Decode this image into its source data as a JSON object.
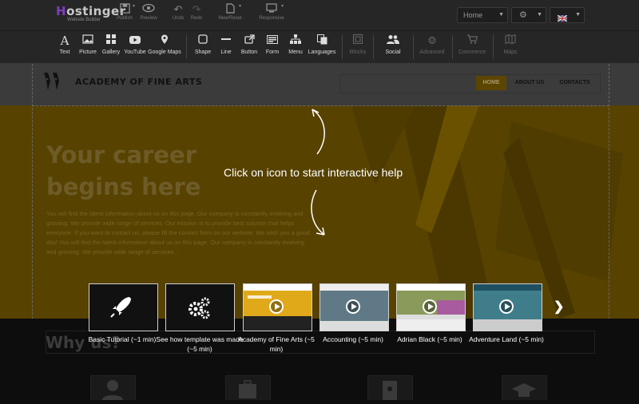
{
  "app": {
    "logo_text": "ostinger",
    "logo_initial": "H",
    "logo_subtitle": "Website Builder"
  },
  "topbar": {
    "buttons": [
      {
        "name": "publish",
        "label": "Publish",
        "icon": "save-icon"
      },
      {
        "name": "preview",
        "label": "Preview",
        "icon": "eye-icon"
      },
      {
        "name": "undo",
        "label": "Undo",
        "icon": "undo-icon"
      },
      {
        "name": "redo",
        "label": "Redo",
        "icon": "redo-icon"
      },
      {
        "name": "new-reset",
        "label": "New/Reset",
        "icon": "file-icon"
      },
      {
        "name": "responsive",
        "label": "Responsive",
        "icon": "monitor-icon"
      }
    ],
    "page_select": "Home",
    "settings_icon": "gear-icon",
    "language_icon": "uk-flag-icon"
  },
  "toolbar": {
    "tools": [
      {
        "label": "Text",
        "icon": "text-icon",
        "enabled": true
      },
      {
        "label": "Picture",
        "icon": "picture-icon",
        "enabled": true
      },
      {
        "label": "Gallery",
        "icon": "gallery-icon",
        "enabled": true
      },
      {
        "label": "YouTube",
        "icon": "youtube-icon",
        "enabled": true
      },
      {
        "label": "Google Maps",
        "icon": "map-pin-icon",
        "enabled": true
      },
      {
        "label": "Shape",
        "icon": "shape-icon",
        "enabled": true
      },
      {
        "label": "Line",
        "icon": "line-icon",
        "enabled": true
      },
      {
        "label": "Button",
        "icon": "button-icon",
        "enabled": true
      },
      {
        "label": "Form",
        "icon": "form-icon",
        "enabled": true
      },
      {
        "label": "Menu",
        "icon": "menu-icon",
        "enabled": true
      },
      {
        "label": "Languages",
        "icon": "languages-icon",
        "enabled": true
      },
      {
        "label": "Blocks",
        "icon": "blocks-icon",
        "enabled": false
      },
      {
        "label": "Social",
        "icon": "social-icon",
        "enabled": true
      },
      {
        "label": "Advanced",
        "icon": "advanced-icon",
        "enabled": false
      },
      {
        "label": "Commerce",
        "icon": "cart-icon",
        "enabled": false
      },
      {
        "label": "Maps",
        "icon": "maps-icon",
        "enabled": false
      }
    ]
  },
  "site": {
    "title": "ACADEMY OF FINE ARTS",
    "nav": [
      {
        "label": "HOME",
        "active": true
      },
      {
        "label": "ABOUT US",
        "active": false
      },
      {
        "label": "CONTACTS",
        "active": false
      }
    ],
    "hero_title": "Your career begins here",
    "hero_body": "You will find the latest information about us on this page. Our company is constantly evolving and growing. We provide wide range of services. Our mission is to provide best solution that helps everyone. If you want to contact us, please fill the contact form on our website. We wish you a good day! You will find the latest information about us on this page. Our company is constantly evolving and growing. We provide wide range of services...",
    "why_title": "Why us?"
  },
  "help": {
    "message": "Click on icon to start interactive help",
    "tutorials": [
      {
        "label": "Basic Tutorial (~1 min)",
        "icon": "rocket-icon",
        "kind": "icon"
      },
      {
        "label": "See how template was made (~5 min)",
        "icon": "gears-icon",
        "kind": "icon"
      },
      {
        "label": "Academy of Fine Arts (~5 min)",
        "kind": "thumb",
        "color": "#e0a91a"
      },
      {
        "label": "Accounting (~5 min)",
        "kind": "thumb",
        "color": "#5f7a86"
      },
      {
        "label": "Adrian Black (~5 min)",
        "kind": "thumb",
        "color": "#a85b9e"
      },
      {
        "label": "Adventure Land (~5 min)",
        "kind": "thumb",
        "color": "#3f7d8a"
      }
    ],
    "next_icon": "chevron-right-icon"
  },
  "colors": {
    "accent": "#ffb400",
    "brand": "#7d3fbf",
    "hero_bg": "#574200"
  }
}
